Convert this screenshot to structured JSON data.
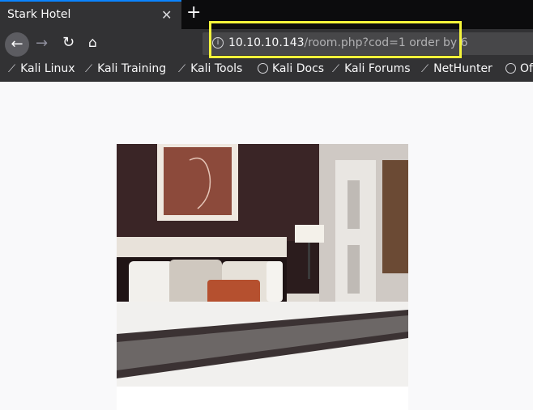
{
  "browser": {
    "tab": {
      "title": "Stark Hotel",
      "close_icon": "close-icon"
    },
    "new_tab_icon": "plus-icon",
    "nav": {
      "back_icon": "back-arrow-icon",
      "forward_icon": "forward-arrow-icon",
      "reload_icon": "reload-icon",
      "home_icon": "home-icon"
    },
    "url": {
      "host": "10.10.10.143",
      "path": "/room.php?cod=1 order by 6"
    },
    "bookmarks": [
      {
        "label": "Kali Linux",
        "icon": "kali-dragon-icon"
      },
      {
        "label": "Kali Training",
        "icon": "kali-dragon-icon"
      },
      {
        "label": "Kali Tools",
        "icon": "kali-dragon-icon"
      },
      {
        "label": "Kali Docs",
        "icon": "globe-icon"
      },
      {
        "label": "Kali Forums",
        "icon": "kali-dragon-icon"
      },
      {
        "label": "NetHunter",
        "icon": "kali-dragon-icon"
      },
      {
        "label": "Of",
        "icon": "globe-icon"
      }
    ]
  },
  "page": {
    "image": "hotel-room-photo"
  },
  "colors": {
    "highlight": "#f5f53a",
    "tab_accent": "#0a84ff",
    "toolbar": "#323234"
  }
}
